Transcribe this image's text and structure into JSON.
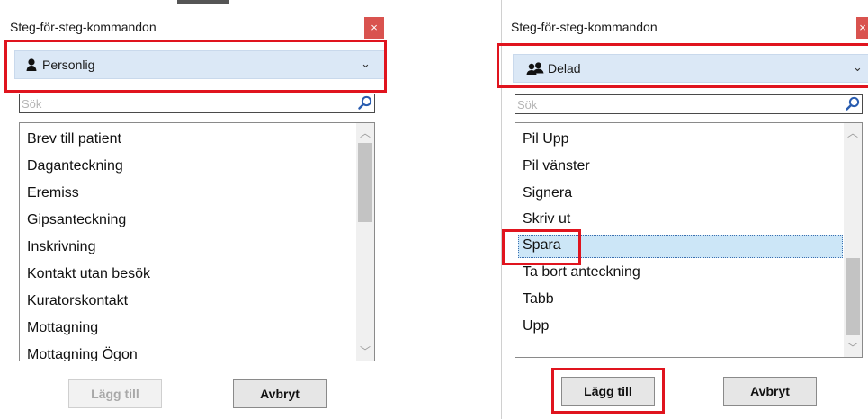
{
  "left_panel": {
    "title": "Steg-för-steg-kommandon",
    "close_glyph": "×",
    "dropdown": {
      "icon": "single-user-icon",
      "selected": "Personlig",
      "chevron": "⌄"
    },
    "search": {
      "placeholder": "Sök",
      "value": ""
    },
    "list_items": [
      "Brev till patient",
      "Daganteckning",
      "Eremiss",
      "Gipsanteckning",
      "Inskrivning",
      "Kontakt utan besök",
      "Kuratorskontakt",
      "Mottagning",
      "Mottagning Ögon"
    ],
    "buttons": {
      "add_label": "Lägg till",
      "cancel_label": "Avbryt"
    }
  },
  "right_panel": {
    "title": "Steg-för-steg-kommandon",
    "close_glyph": "×",
    "dropdown": {
      "icon": "two-users-icon",
      "selected": "Delad",
      "chevron": "⌄"
    },
    "search": {
      "placeholder": "Sök",
      "value": ""
    },
    "list_items": [
      "Pil Upp",
      "Pil vänster",
      "Signera",
      "Skriv ut",
      "Spara",
      "Ta bort anteckning",
      "Tabb",
      "Upp"
    ],
    "selected_item": "Spara",
    "buttons": {
      "add_label": "Lägg till",
      "cancel_label": "Avbryt"
    }
  },
  "colors": {
    "highlight_red": "#e0141e",
    "dropdown_bg": "#dbe8f6",
    "selection_bg": "#cce6f7",
    "close_red": "#d9534f"
  }
}
